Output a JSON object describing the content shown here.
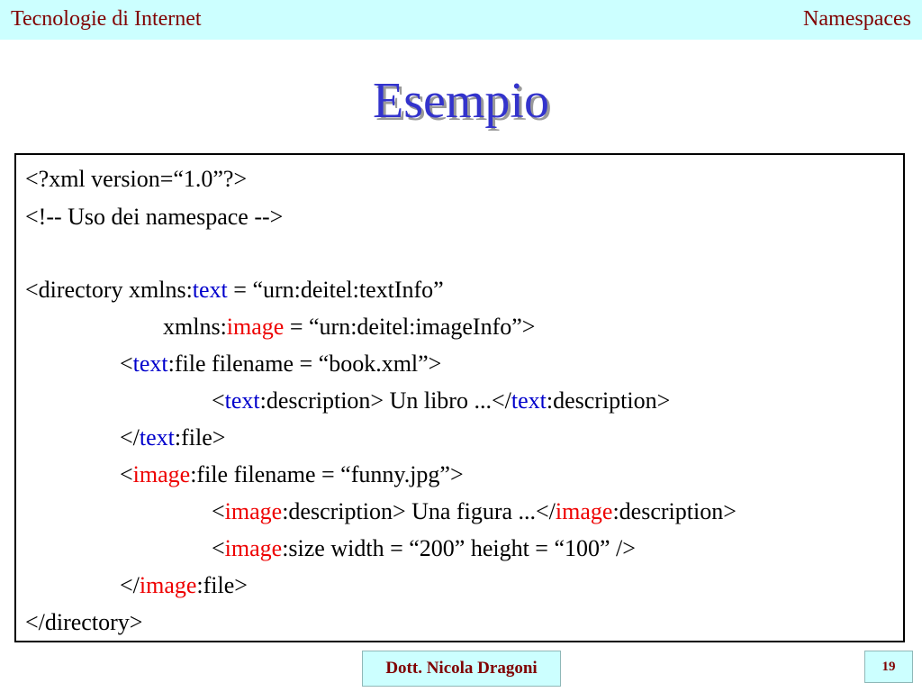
{
  "header": {
    "course": "Tecnologie di Internet",
    "topic": "Namespaces"
  },
  "slide": {
    "title": "Esempio"
  },
  "code": {
    "l1": "<?xml version=“1.0”?>",
    "l2": "<!-- Uso dei namespace -->",
    "l3_a": "<directory xmlns:",
    "l3_b": "text",
    "l3_c": " = “urn:deitel:textInfo”",
    "l4_a": "xmlns:",
    "l4_b": "image",
    "l4_c": " = “urn:deitel:imageInfo”>",
    "l5_a": "<",
    "l5_b": "text",
    "l5_c": ":file filename = “book.xml”>",
    "l6_a": "<",
    "l6_b": "text",
    "l6_c": ":description> Un libro ...</",
    "l6_d": "text",
    "l6_e": ":description>",
    "l7_a": "</",
    "l7_b": "text",
    "l7_c": ":file>",
    "l8_a": "<",
    "l8_b": "image",
    "l8_c": ":file filename = “funny.jpg”>",
    "l9_a": "<",
    "l9_b": "image",
    "l9_c": ":description> Una figura ...</",
    "l9_d": "image",
    "l9_e": ":description>",
    "l10_a": "<",
    "l10_b": "image",
    "l10_c": ":size width = “200” height = “100” />",
    "l11_a": "</",
    "l11_b": "image",
    "l11_c": ":file>",
    "l12": "</directory>"
  },
  "footer": {
    "author": "Dott. Nicola Dragoni",
    "page": "19"
  },
  "colors": {
    "header_bg": "#ccffff",
    "header_text": "#800000",
    "title": "#3333cc",
    "text_prefix": "#0000cc",
    "image_prefix": "#ee0000"
  }
}
